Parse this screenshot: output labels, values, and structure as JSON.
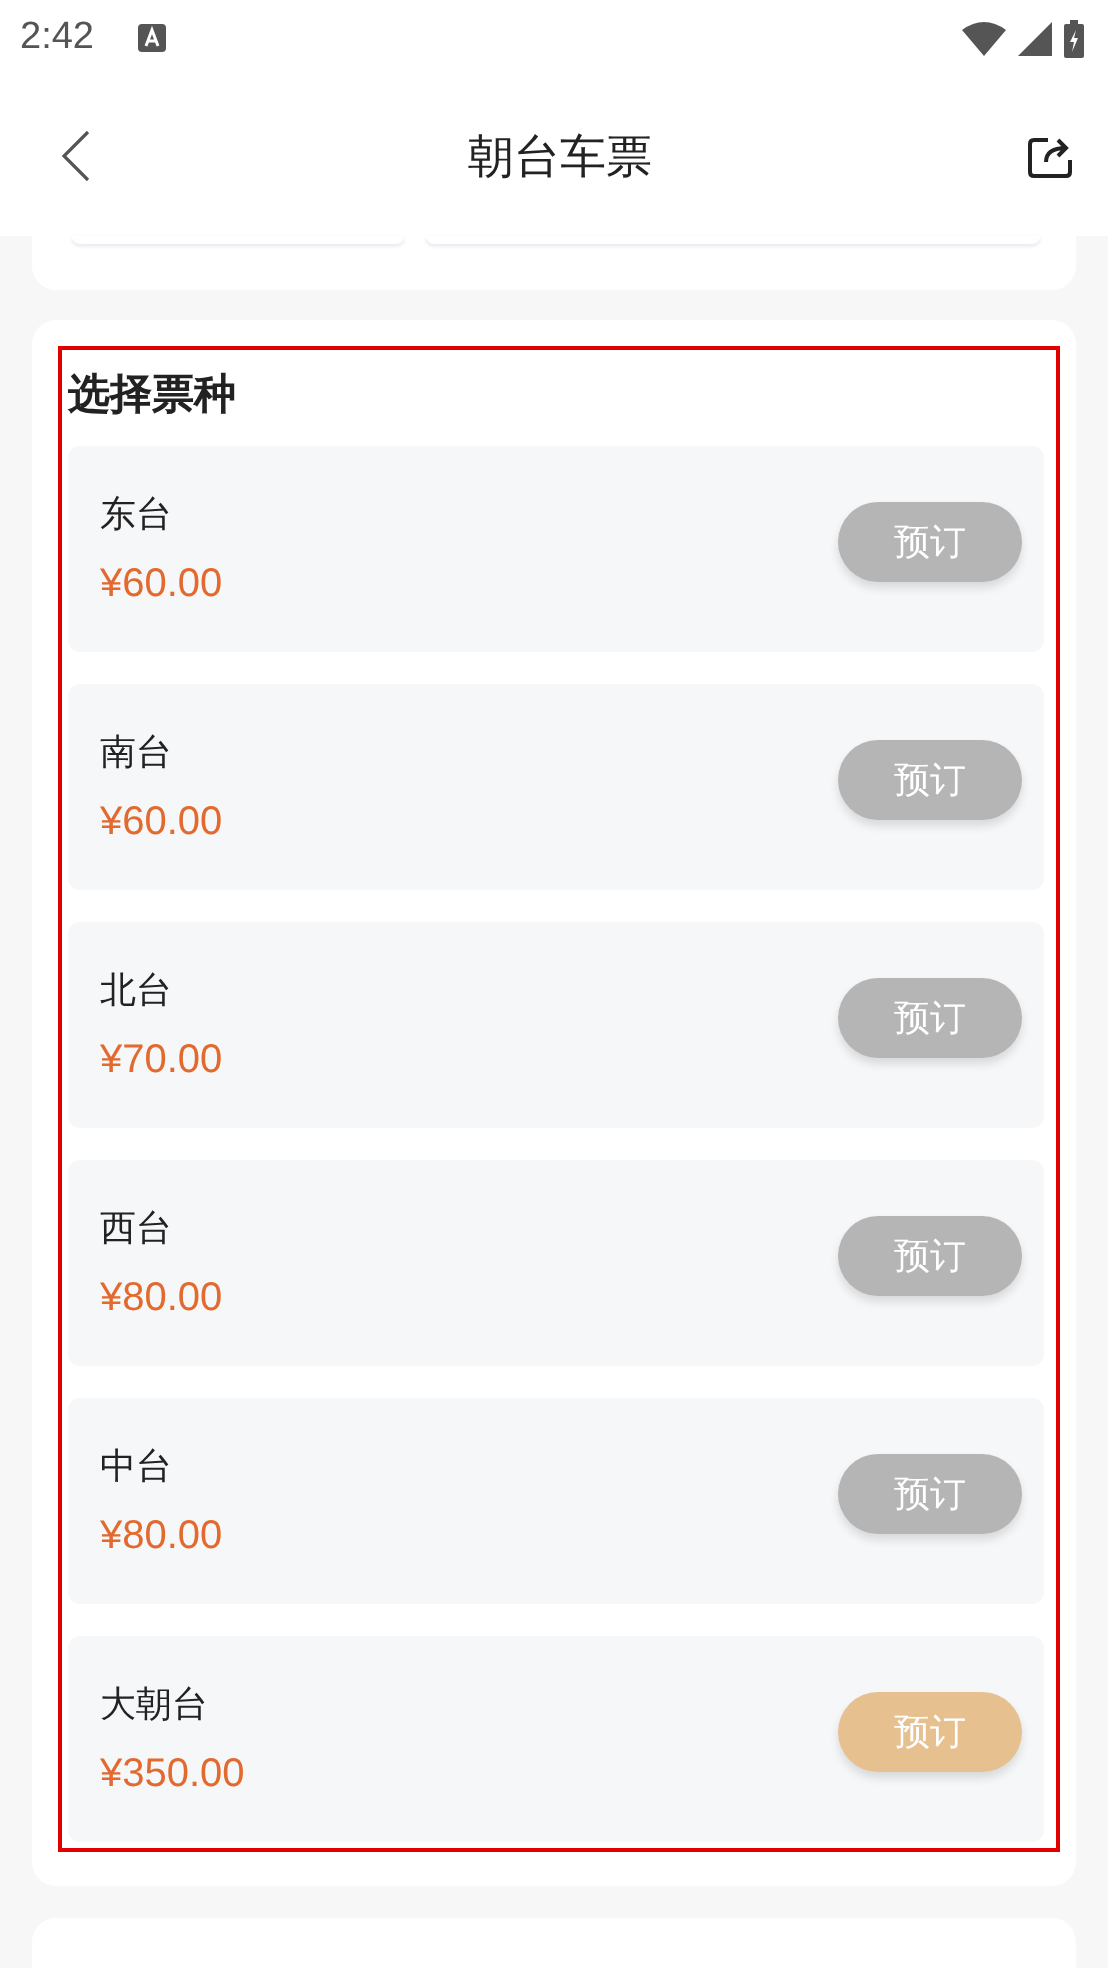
{
  "status_bar": {
    "time": "2:42"
  },
  "header": {
    "title": "朝台车票"
  },
  "ticket_section": {
    "title": "选择票种",
    "highlighted": true,
    "tickets": [
      {
        "name": "东台",
        "price": "¥60.00",
        "button": "预订",
        "disabled": true
      },
      {
        "name": "南台",
        "price": "¥60.00",
        "button": "预订",
        "disabled": true
      },
      {
        "name": "北台",
        "price": "¥70.00",
        "button": "预订",
        "disabled": true
      },
      {
        "name": "西台",
        "price": "¥80.00",
        "button": "预订",
        "disabled": true
      },
      {
        "name": "中台",
        "price": "¥80.00",
        "button": "预订",
        "disabled": true
      },
      {
        "name": "大朝台",
        "price": "¥350.00",
        "button": "预订",
        "disabled": false
      }
    ]
  }
}
